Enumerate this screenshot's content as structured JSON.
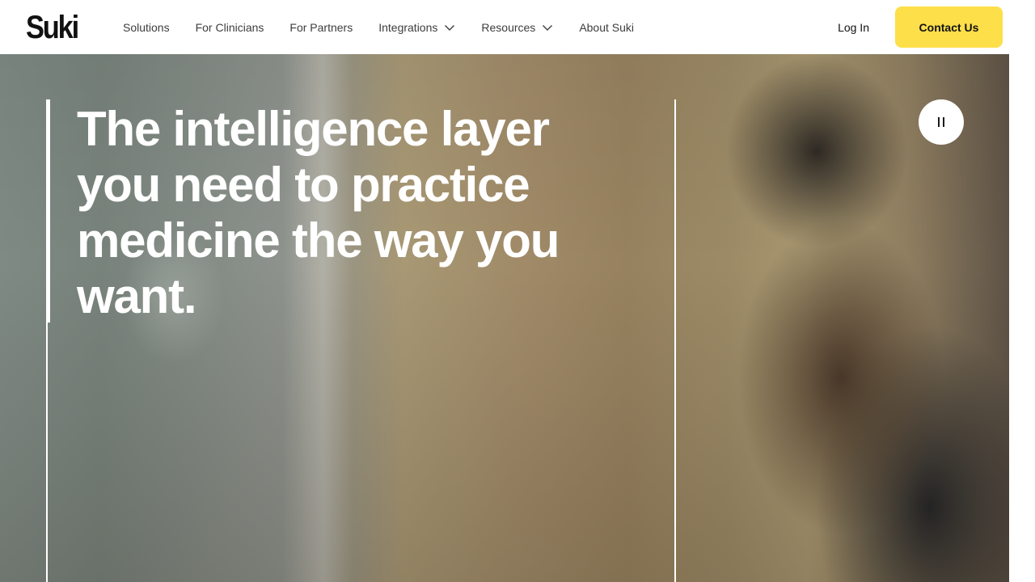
{
  "header": {
    "logo_text": "Suki",
    "nav": [
      {
        "label": "Solutions",
        "has_dropdown": false
      },
      {
        "label": "For Clinicians",
        "has_dropdown": false
      },
      {
        "label": "For Partners",
        "has_dropdown": false
      },
      {
        "label": "Integrations",
        "has_dropdown": true
      },
      {
        "label": "Resources",
        "has_dropdown": true
      },
      {
        "label": "About Suki",
        "has_dropdown": false
      }
    ],
    "login_label": "Log In",
    "contact_label": "Contact Us"
  },
  "hero": {
    "headline": "The intelligence layer you need to practice medicine the way you want.",
    "video_control_icon": "pause-icon"
  },
  "colors": {
    "accent": "#fddf4a",
    "nav_text": "#3d3d3d",
    "headline_text": "#ffffff"
  }
}
